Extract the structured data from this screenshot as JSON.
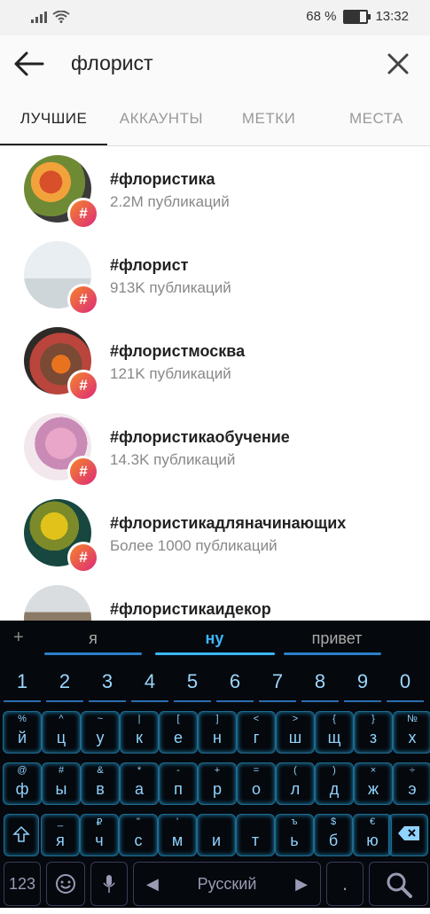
{
  "status": {
    "battery": "68 %",
    "time": "13:32"
  },
  "search": {
    "query": "флорист"
  },
  "tabs": [
    "ЛУЧШИЕ",
    "АККАУНТЫ",
    "МЕТКИ",
    "МЕСТА"
  ],
  "results": [
    {
      "title": "#флористика",
      "sub": "2.2M публикаций"
    },
    {
      "title": "#флорист",
      "sub": "913K публикаций"
    },
    {
      "title": "#флористмосква",
      "sub": "121K публикаций"
    },
    {
      "title": "#флористикаобучение",
      "sub": "14.3K публикаций"
    },
    {
      "title": "#флористикадляначинающих",
      "sub": "Более 1000 публикаций"
    },
    {
      "title": "#флористикаидекор",
      "sub": ""
    }
  ],
  "keyboard": {
    "suggestions": [
      "я",
      "ну",
      "привет"
    ],
    "numbers": [
      "1",
      "2",
      "3",
      "4",
      "5",
      "6",
      "7",
      "8",
      "9",
      "0"
    ],
    "row1": {
      "keys": [
        "й",
        "ц",
        "у",
        "к",
        "е",
        "н",
        "г",
        "ш",
        "щ",
        "з",
        "х"
      ],
      "hints": [
        "%",
        "^",
        "~",
        "|",
        "[",
        "]",
        "<",
        ">",
        "{",
        "}",
        "№"
      ]
    },
    "row2": {
      "keys": [
        "ф",
        "ы",
        "в",
        "а",
        "п",
        "р",
        "о",
        "л",
        "д",
        "ж",
        "э"
      ],
      "hints": [
        "@",
        "#",
        "&",
        "*",
        "-",
        "+",
        "=",
        "(",
        ")",
        "×",
        "÷"
      ]
    },
    "row3": {
      "keys": [
        "я",
        "ч",
        "с",
        "м",
        "и",
        "т",
        "ь",
        "б",
        "ю"
      ],
      "hints": [
        "_",
        "₽",
        "\"",
        "'",
        "",
        "",
        "ъ",
        "$",
        "€"
      ]
    },
    "bottom": {
      "num_label": "123",
      "space_label": "Русский"
    }
  }
}
